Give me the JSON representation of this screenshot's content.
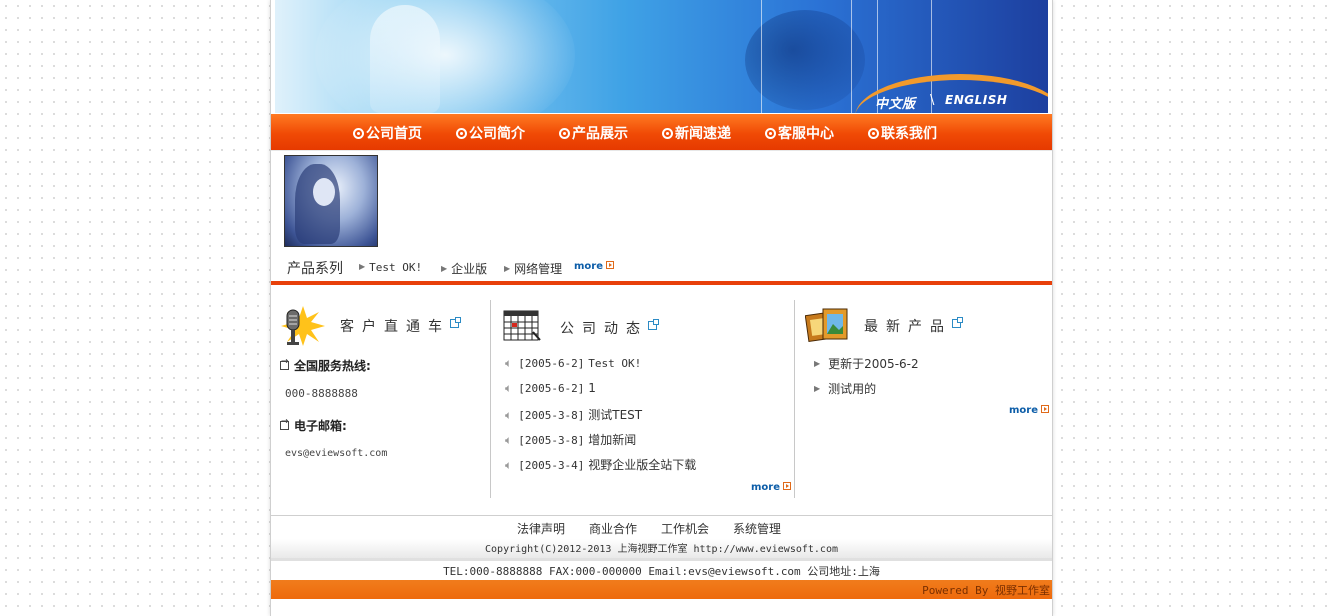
{
  "header": {
    "lang_cn": "中文版",
    "lang_sep": "\\",
    "lang_en": "ENGLISH"
  },
  "nav": {
    "items": [
      {
        "label": "公司首页"
      },
      {
        "label": "公司简介"
      },
      {
        "label": "产品展示"
      },
      {
        "label": "新闻速递"
      },
      {
        "label": "客服中心"
      },
      {
        "label": "联系我们"
      }
    ]
  },
  "products_bar": {
    "title": "产品系列",
    "links": [
      {
        "label": "Test OK!"
      },
      {
        "label": "企业版"
      },
      {
        "label": "网络管理"
      }
    ],
    "more": "more"
  },
  "customer": {
    "title": "客户直通车",
    "hotline_label": "全国服务热线:",
    "hotline_value": "000-8888888",
    "email_label": "电子邮箱:",
    "email_value": "evs@eviewsoft.com"
  },
  "news": {
    "title": "公司动态",
    "items": [
      {
        "date": "[2005-6-2]",
        "title": "Test OK!"
      },
      {
        "date": "[2005-6-2]",
        "title": "1"
      },
      {
        "date": "[2005-3-8]",
        "title": "测试TEST"
      },
      {
        "date": "[2005-3-8]",
        "title": "增加新闻"
      },
      {
        "date": "[2005-3-4]",
        "title": "视野企业版全站下载"
      }
    ],
    "more": "more"
  },
  "latest_products": {
    "title": "最新产品",
    "items": [
      {
        "label": "更新于2005-6-2"
      },
      {
        "label": "测试用的"
      }
    ],
    "more": "more"
  },
  "footer": {
    "links": [
      {
        "label": "法律声明"
      },
      {
        "label": "商业合作"
      },
      {
        "label": "工作机会"
      },
      {
        "label": "系统管理"
      }
    ],
    "copyright": "Copyright(C)2012-2013 上海视野工作室 http://www.eviewsoft.com",
    "contact": "TEL:000-8888888 FAX:000-000000 Email:evs@eviewsoft.com 公司地址:上海",
    "powered": "Powered By 视野工作室"
  },
  "colors": {
    "nav_orange": "#f04a05",
    "accent_rule": "#e8400a",
    "more_blue": "#0c5da8",
    "banner_blue": "#2b73d6"
  }
}
